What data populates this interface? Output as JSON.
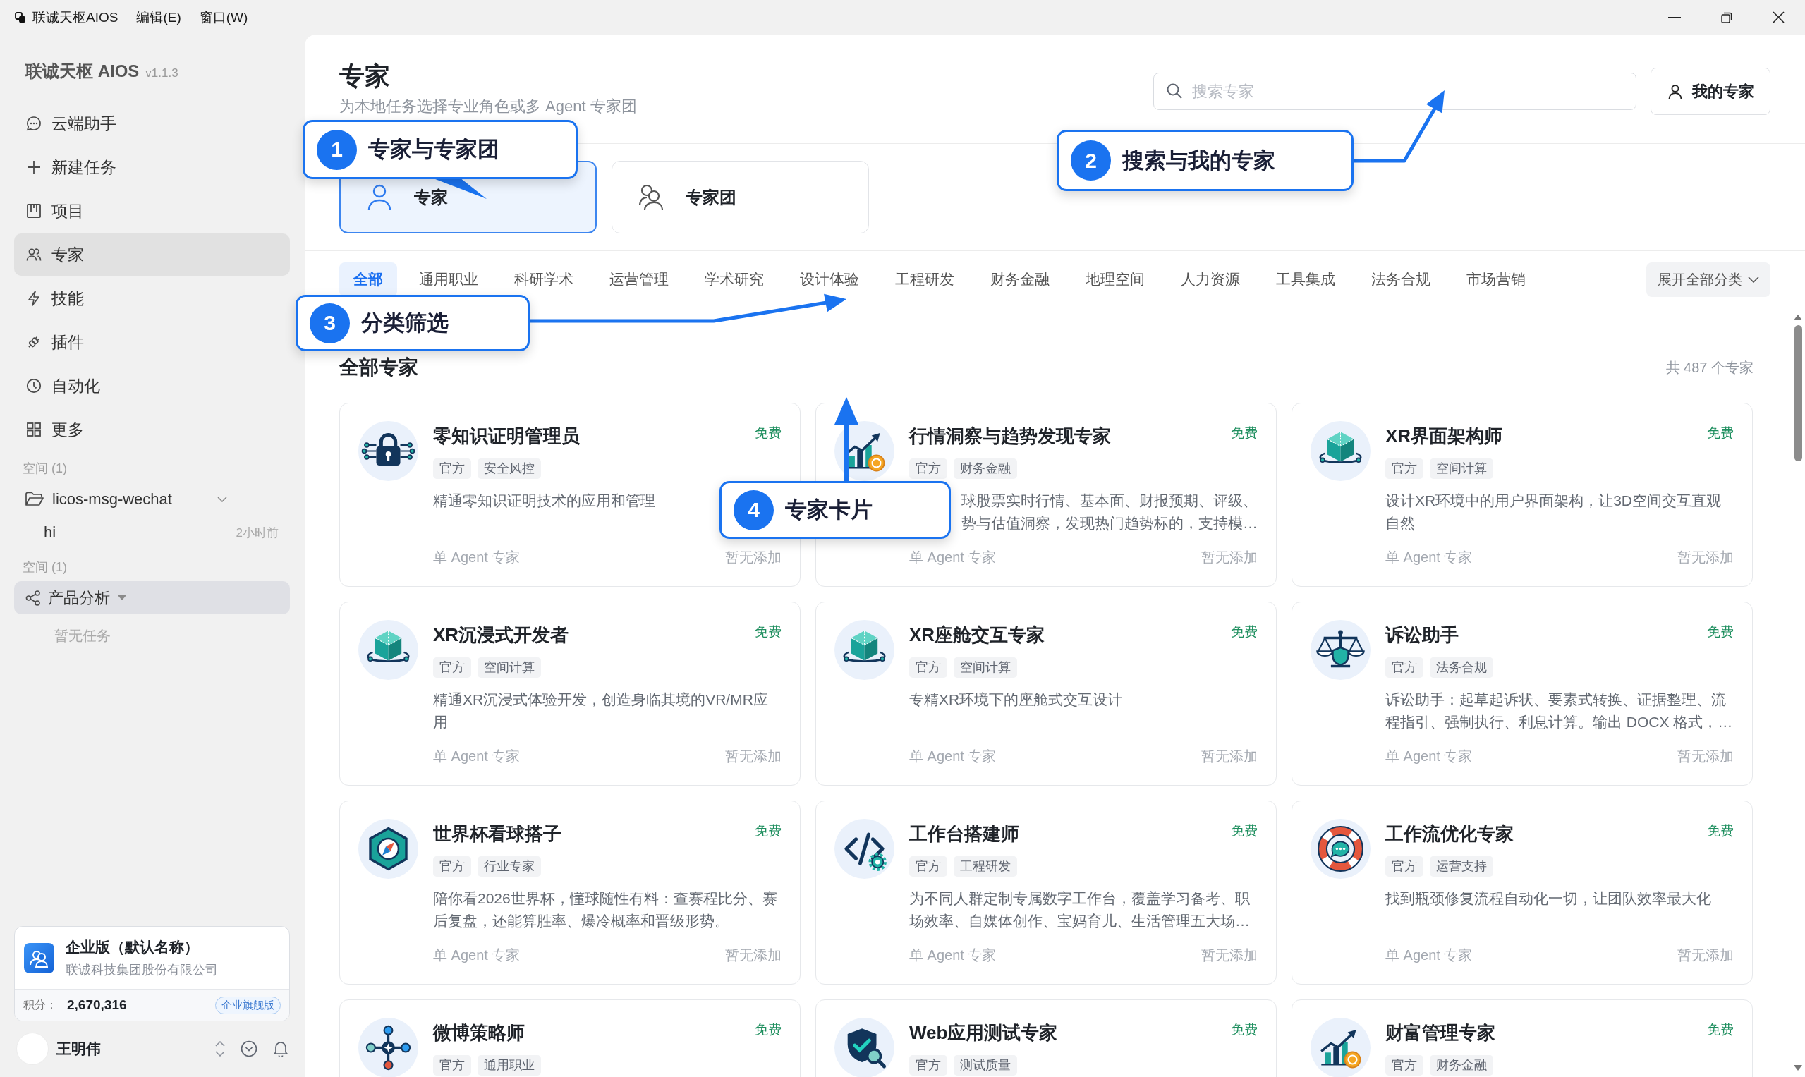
{
  "titlebar": {
    "app_name": "联诚天枢AIOS",
    "menus": [
      "编辑(E)",
      "窗口(W)"
    ]
  },
  "sidebar": {
    "brand": "联诚天枢 AIOS",
    "version": "v1.1.3",
    "nav": [
      {
        "label": "云端助手",
        "selected": false
      },
      {
        "label": "新建任务",
        "selected": false
      },
      {
        "label": "项目",
        "selected": false
      },
      {
        "label": "专家",
        "selected": true
      },
      {
        "label": "技能",
        "selected": false
      },
      {
        "label": "插件",
        "selected": false
      },
      {
        "label": "自动化",
        "selected": false
      },
      {
        "label": "更多",
        "selected": false
      }
    ],
    "spaces": [
      {
        "label": "空间 (1)",
        "projects": [
          {
            "name": "licos-msg-wechat",
            "kind": "folder",
            "selected": false,
            "expanded": true,
            "tasks": [
              {
                "name": "hi",
                "time": "2小时前"
              }
            ]
          }
        ]
      },
      {
        "label": "空间 (1)",
        "projects": [
          {
            "name": "产品分析",
            "kind": "shared",
            "selected": true,
            "expanded": true,
            "empty_text": "暂无任务"
          }
        ]
      }
    ],
    "account": {
      "plan": "企业版（默认名称）",
      "company": "联诚科技集团股份有限公司",
      "points_label": "积分：",
      "points": "2,670,316",
      "badge": "企业旗舰版"
    },
    "user": {
      "name": "王明伟"
    }
  },
  "header": {
    "title": "专家",
    "subtitle": "为本地任务选择专业角色或多 Agent 专家团",
    "search": {
      "placeholder": "搜索专家"
    },
    "my_experts_button": "我的专家"
  },
  "mode_tabs": [
    {
      "label": "专家",
      "selected": true
    },
    {
      "label": "专家团",
      "selected": false
    }
  ],
  "categories": {
    "items": [
      {
        "label": "全部",
        "selected": true
      },
      {
        "label": "通用职业",
        "selected": false
      },
      {
        "label": "科研学术",
        "selected": false
      },
      {
        "label": "运营管理",
        "selected": false
      },
      {
        "label": "学术研究",
        "selected": false
      },
      {
        "label": "设计体验",
        "selected": false
      },
      {
        "label": "工程研发",
        "selected": false
      },
      {
        "label": "财务金融",
        "selected": false
      },
      {
        "label": "地理空间",
        "selected": false
      },
      {
        "label": "人力资源",
        "selected": false
      },
      {
        "label": "工具集成",
        "selected": false
      },
      {
        "label": "法务合规",
        "selected": false
      },
      {
        "label": "市场营销",
        "selected": false
      }
    ],
    "expand_button": "展开全部分类"
  },
  "experts": {
    "heading": "全部专家",
    "count": "共 487 个专家",
    "cards": [
      {
        "title": "零知识证明管理员",
        "price": "免费",
        "tags": [
          "官方",
          "安全风控"
        ],
        "description": "精通零知识证明技术的应用和管理",
        "type": "单 Agent 专家",
        "status": "暂无添加"
      },
      {
        "title": "行情洞察与趋势发现专家",
        "price": "免费",
        "tags": [
          "官方",
          "财务金融"
        ],
        "description": [
          "球股票实时行情、基本面、财报预期、评级、",
          "势与估值洞察，发现热门趋势标的，支持模…"
        ],
        "type": "单 Agent 专家",
        "status": "暂无添加"
      },
      {
        "title": "XR界面架构师",
        "price": "免费",
        "tags": [
          "官方",
          "空间计算"
        ],
        "description": "设计XR环境中的用户界面架构，让3D空间交互直观自然",
        "type": "单 Agent 专家",
        "status": "暂无添加"
      },
      {
        "title": "XR沉浸式开发者",
        "price": "免费",
        "tags": [
          "官方",
          "空间计算"
        ],
        "description": "精通XR沉浸式体验开发，创造身临其境的VR/MR应用",
        "type": "单 Agent 专家",
        "status": "暂无添加"
      },
      {
        "title": "XR座舱交互专家",
        "price": "免费",
        "tags": [
          "官方",
          "空间计算"
        ],
        "description": "专精XR环境下的座舱式交互设计",
        "type": "单 Agent 专家",
        "status": "暂无添加"
      },
      {
        "title": "诉讼助手",
        "price": "免费",
        "tags": [
          "官方",
          "法务合规"
        ],
        "description": "诉讼助手：起草起诉状、要素式转换、证据整理、流程指引、强制执行、利息计算。输出 DOCX 格式，…",
        "type": "单 Agent 专家",
        "status": "暂无添加"
      },
      {
        "title": "世界杯看球搭子",
        "price": "免费",
        "tags": [
          "官方",
          "行业专家"
        ],
        "description": "陪你看2026世界杯，懂球随性有料：查赛程比分、赛后复盘，还能算胜率、爆冷概率和晋级形势。",
        "type": "单 Agent 专家",
        "status": "暂无添加"
      },
      {
        "title": "工作台搭建师",
        "price": "免费",
        "tags": [
          "官方",
          "工程研发"
        ],
        "description": "为不同人群定制专属数字工作台，覆盖学习备考、职场效率、自媒体创作、宝妈育儿、生活管理五大场…",
        "type": "单 Agent 专家",
        "status": "暂无添加"
      },
      {
        "title": "工作流优化专家",
        "price": "免费",
        "tags": [
          "官方",
          "运营支持"
        ],
        "description": "找到瓶颈修复流程自动化一切，让团队效率最大化",
        "type": "单 Agent 专家",
        "status": "暂无添加"
      },
      {
        "title": "微博策略师",
        "price": "免费",
        "tags": [
          "官方",
          "通用职业"
        ]
      },
      {
        "title": "Web应用测试专家",
        "price": "免费",
        "tags": [
          "官方",
          "测试质量"
        ]
      },
      {
        "title": "财富管理专家",
        "price": "免费",
        "tags": [
          "官方",
          "财务金融"
        ]
      }
    ]
  },
  "callouts": [
    {
      "number": "1",
      "text": "专家与专家团"
    },
    {
      "number": "2",
      "text": "搜索与我的专家"
    },
    {
      "number": "3",
      "text": "分类筛选"
    },
    {
      "number": "4",
      "text": "专家卡片"
    }
  ]
}
